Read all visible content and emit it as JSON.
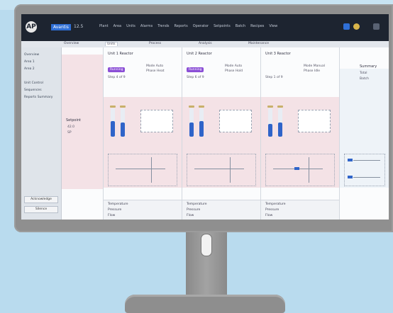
{
  "app": {
    "logo": "AP",
    "brand_badge": "Avantis",
    "brand_sub": "12.5",
    "top_menu": [
      "Plant",
      "Area",
      "Units",
      "Alarms",
      "Trends",
      "Reports",
      "Operator",
      "Setpoints",
      "Batch",
      "Recipes",
      "View"
    ]
  },
  "tabs": [
    "Overview",
    "Units",
    "Process",
    "Analysis",
    "Maintenance"
  ],
  "sidebar": {
    "items": [
      "Overview",
      "Area 1",
      "Area 2",
      "Unit Control",
      "Sequences",
      "Reports Summary"
    ],
    "buttons": [
      "Acknowledge",
      "Silence"
    ]
  },
  "columns": [
    {
      "title": "Setpoint",
      "values": [
        "42.0",
        "SP"
      ]
    },
    {
      "title": "Unit 1 Reactor",
      "pill": "Running",
      "meta": [
        "Mode Auto",
        "Phase Heat",
        "Step 4 of 9"
      ],
      "levels": [
        0.55,
        0.5
      ],
      "footer": [
        "Temperature",
        "Pressure",
        "Flow"
      ]
    },
    {
      "title": "Unit 2 Reactor",
      "pill": "Running",
      "meta": [
        "Mode Auto",
        "Phase Hold",
        "Step 6 of 9"
      ],
      "levels": [
        0.5,
        0.55
      ],
      "footer": [
        "Temperature",
        "Pressure",
        "Flow"
      ]
    },
    {
      "title": "Unit 3 Reactor",
      "pill": "",
      "meta": [
        "Mode Manual",
        "Phase Idle",
        "Step 1 of 9"
      ],
      "levels": [
        0.45,
        0.5
      ],
      "footer": [
        "Temperature",
        "Pressure",
        "Flow"
      ]
    },
    {
      "title": "Summary",
      "values": [
        "Total",
        "Batch"
      ]
    }
  ],
  "colors": {
    "accent": "#2f64c9",
    "pill": "#8b4fd6",
    "band": "#f4e2e6",
    "topbar": "#1d2430"
  }
}
